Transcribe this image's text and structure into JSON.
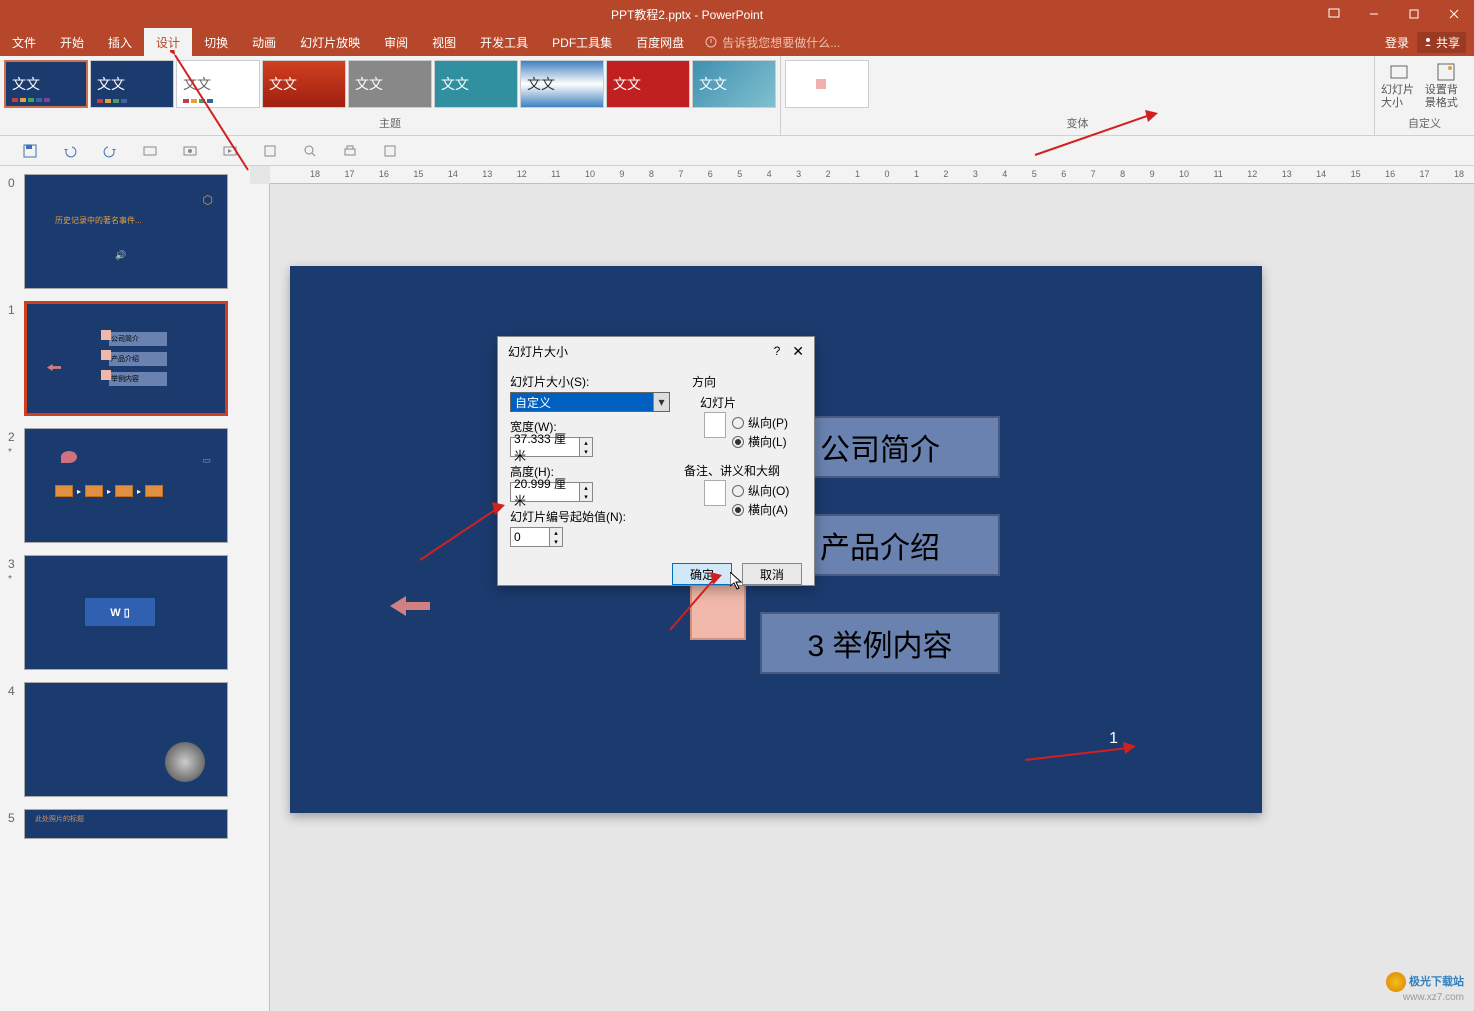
{
  "title": "PPT教程2.pptx - PowerPoint",
  "tabs": {
    "file": "文件",
    "home": "开始",
    "insert": "插入",
    "design": "设计",
    "transitions": "切换",
    "animations": "动画",
    "slideshow": "幻灯片放映",
    "review": "审阅",
    "view": "视图",
    "developer": "开发工具",
    "pdf": "PDF工具集",
    "baidu": "百度网盘"
  },
  "tell_me": "告诉我您想要做什么...",
  "login": "登录",
  "share": "共享",
  "theme_text": "文文",
  "group_themes": "主题",
  "group_variants": "变体",
  "group_custom": "自定义",
  "btn_slide_size": "幻灯片大小",
  "btn_bg_format": "设置背景格式",
  "slides": {
    "n0": "0",
    "n1": "1",
    "n2": "2",
    "n3": "3",
    "n4": "4",
    "n5": "5",
    "star": "*"
  },
  "slide0_title": "历史记录中的著名事件...",
  "slide1_items": [
    "公司简介",
    "产品介绍",
    "举例内容"
  ],
  "canvas": {
    "item1": "公司简介",
    "item2": "产品介绍",
    "item3": "3 举例内容",
    "pagenum": "1"
  },
  "dialog": {
    "title": "幻灯片大小",
    "help": "?",
    "close": "✕",
    "size_label": "幻灯片大小(S):",
    "size_value": "自定义",
    "width_label": "宽度(W):",
    "width_value": "37.333 厘米",
    "height_label": "高度(H):",
    "height_value": "20.999 厘米",
    "start_num_label": "幻灯片编号起始值(N):",
    "start_num_value": "0",
    "orientation": "方向",
    "slides_label": "幻灯片",
    "portrait_p": "纵向(P)",
    "landscape_l": "横向(L)",
    "notes_label": "备注、讲义和大纲",
    "portrait_o": "纵向(O)",
    "landscape_a": "横向(A)",
    "ok": "确定",
    "cancel": "取消"
  },
  "watermark": {
    "txt1": "极光下载站",
    "txt2": "www.xz7.com"
  },
  "ruler_marks": [
    "18",
    "17",
    "16",
    "15",
    "14",
    "13",
    "12",
    "11",
    "10",
    "9",
    "8",
    "7",
    "6",
    "5",
    "4",
    "3",
    "2",
    "1",
    "0",
    "1",
    "2",
    "3",
    "4",
    "5",
    "6",
    "7",
    "8",
    "9",
    "10",
    "11",
    "12",
    "13",
    "14",
    "15",
    "16",
    "17",
    "18"
  ]
}
